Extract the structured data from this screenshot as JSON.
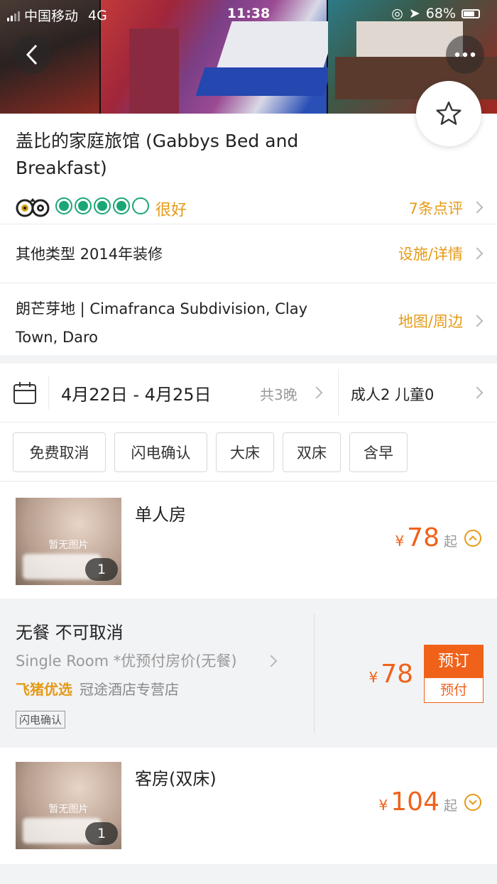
{
  "status_bar": {
    "carrier": "中国移动",
    "network": "4G",
    "time": "11:38",
    "battery": "68%"
  },
  "hotel": {
    "name": "盖比的家庭旅馆 (Gabbys Bed and Breakfast)",
    "rating_label": "很好",
    "rating_score": 4,
    "rating_max": 5,
    "reviews_link": "7条点评",
    "type_info": "其他类型 2014年装修",
    "facilities_link": "设施/详情",
    "address": "朗芒芽地 | Cimafranca Subdivision, Clay Town, Daro",
    "map_link": "地图/周边"
  },
  "booking": {
    "dates": "4月22日 - 4月25日",
    "nights": "共3晚",
    "guests": "成人2 儿童0"
  },
  "filters": [
    "免费取消",
    "闪电确认",
    "大床",
    "双床",
    "含早"
  ],
  "rooms": [
    {
      "name": "单人房",
      "no_image": "暂无图片",
      "photo_count": "1",
      "currency": "¥",
      "price": "78",
      "from": "起"
    },
    {
      "name": "客房(双床)",
      "no_image": "暂无图片",
      "photo_count": "1",
      "currency": "¥",
      "price": "104",
      "from": "起"
    }
  ],
  "offer": {
    "meal": "无餐 不可取消",
    "desc": "Single Room *优预付房价(无餐)",
    "brand": "飞猪优选",
    "shop": "冠途酒店专营店",
    "badge": "闪电确认",
    "currency": "¥",
    "price": "78",
    "book_label": "预订",
    "prepay_label": "预付"
  },
  "colors": {
    "accent": "#e59a16",
    "price": "#f0621a",
    "rating": "#1aa675"
  }
}
